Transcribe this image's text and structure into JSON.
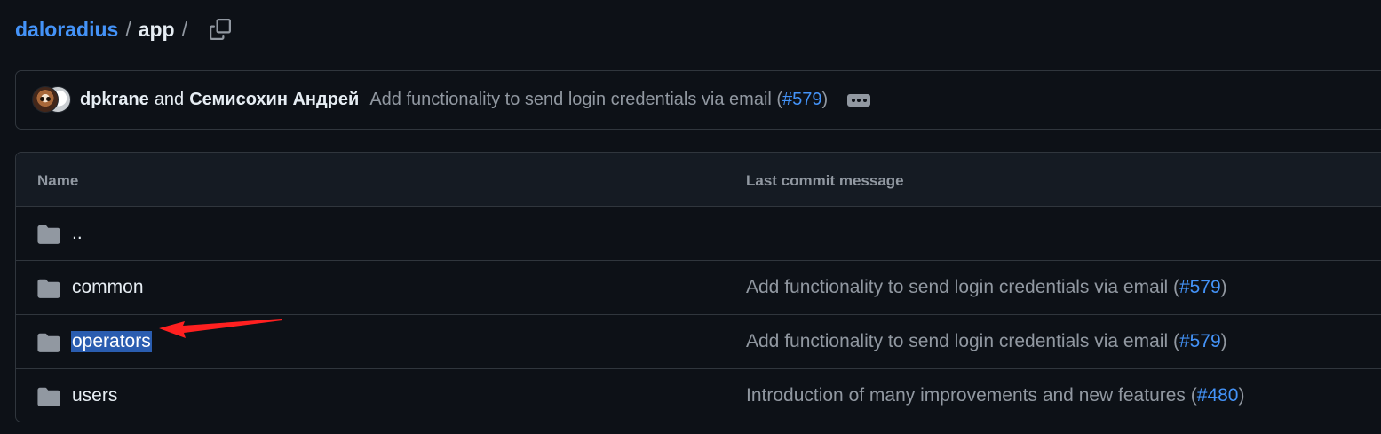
{
  "breadcrumb": {
    "repo": "daloradius",
    "separator": "/",
    "directory": "app",
    "trailing_separator": "/",
    "copy_icon": "copy-icon"
  },
  "latest_commit": {
    "author_primary": "dpkrane",
    "conjunction": "and",
    "author_secondary": "Семисохин Андрей",
    "message": "Add functionality to send login credentials via email (",
    "pr": "#579",
    "message_suffix": ")",
    "more_icon": "ellipsis-icon"
  },
  "file_table": {
    "headers": {
      "name": "Name",
      "last_commit": "Last commit message"
    },
    "rows": [
      {
        "name": "..",
        "icon": "folder-icon",
        "commit_message": "",
        "pr": "",
        "suffix": ""
      },
      {
        "name": "common",
        "icon": "folder-icon",
        "commit_message": "Add functionality to send login credentials via email (",
        "pr": "#579",
        "suffix": ")"
      },
      {
        "name": "operators",
        "icon": "folder-icon",
        "selected": true,
        "commit_message": "Add functionality to send login credentials via email (",
        "pr": "#579",
        "suffix": ")"
      },
      {
        "name": "users",
        "icon": "folder-icon",
        "commit_message": "Introduction of many improvements and new features (",
        "pr": "#480",
        "suffix": ")"
      }
    ]
  },
  "colors": {
    "background": "#0d1117",
    "border": "#30363d",
    "link": "#4493f8",
    "muted_text": "#9198a1",
    "selection": "#2a5db0",
    "annotation_arrow": "#ff2020"
  }
}
